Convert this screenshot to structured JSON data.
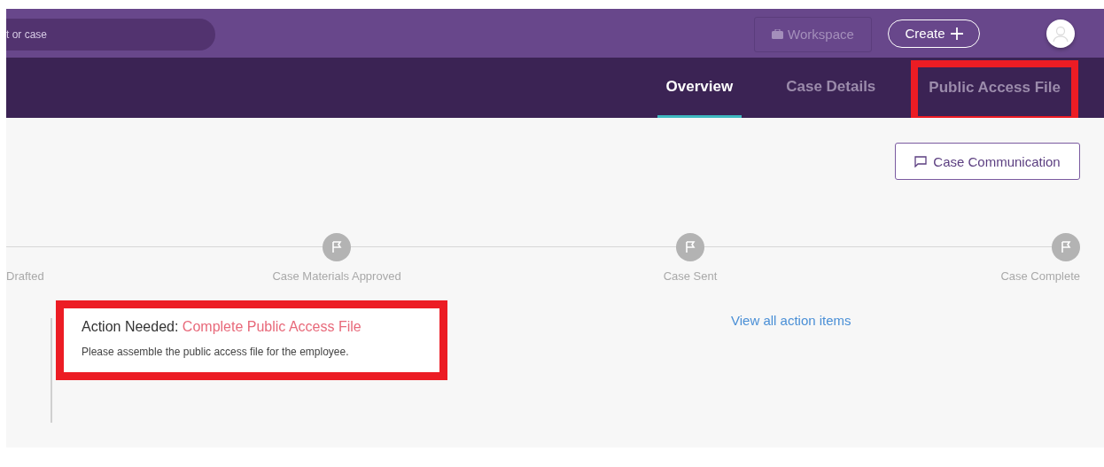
{
  "top_bar": {
    "search": {
      "placeholder": "t or case"
    },
    "workspace_button": "Workspace",
    "create_button": "Create"
  },
  "tabs": [
    {
      "label": "Overview",
      "selected": true,
      "highlighted": false
    },
    {
      "label": "Case Details",
      "selected": false,
      "highlighted": false
    },
    {
      "label": "Public Access File",
      "selected": false,
      "highlighted": true
    }
  ],
  "case_communication_button": "Case Communication",
  "timeline": [
    {
      "label": "Drafted",
      "kind": "cut"
    },
    {
      "label": "Case Materials Approved",
      "kind": "milestone"
    },
    {
      "label": "Case Sent",
      "kind": "milestone"
    },
    {
      "label": "Case Complete",
      "kind": "milestone"
    }
  ],
  "action": {
    "highlighted": true,
    "prefix": "Action Needed:",
    "title": "Complete Public Access File",
    "message": "Please assemble the public access file for the employee."
  },
  "view_all_link": "View all action items"
}
